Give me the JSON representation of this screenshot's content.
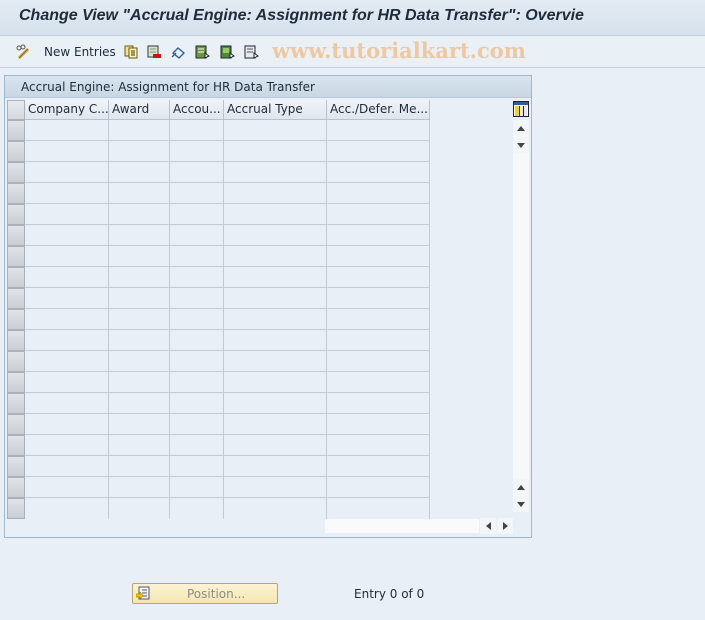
{
  "window": {
    "title": "Change View \"Accrual Engine: Assignment for HR Data Transfer\": Overvie"
  },
  "toolbar": {
    "items": [
      {
        "name": "display-change-icon"
      },
      {
        "name": "new-entries-button",
        "label": "New Entries"
      },
      {
        "name": "copy-as-icon"
      },
      {
        "name": "delete-icon"
      },
      {
        "name": "undo-change-icon"
      },
      {
        "name": "select-all-icon"
      },
      {
        "name": "select-block-icon"
      },
      {
        "name": "deselect-all-icon"
      }
    ]
  },
  "watermark": "www.tutorialkart.com",
  "table": {
    "title": "Accrual Engine: Assignment for HR Data Transfer",
    "columns": [
      "Company C...",
      "Award",
      "Accou...",
      "Accrual Type",
      "Acc./Defer. Me..."
    ],
    "row_count": 19,
    "rows": []
  },
  "footer": {
    "position_button": "Position...",
    "entry_status": "Entry 0 of 0"
  }
}
